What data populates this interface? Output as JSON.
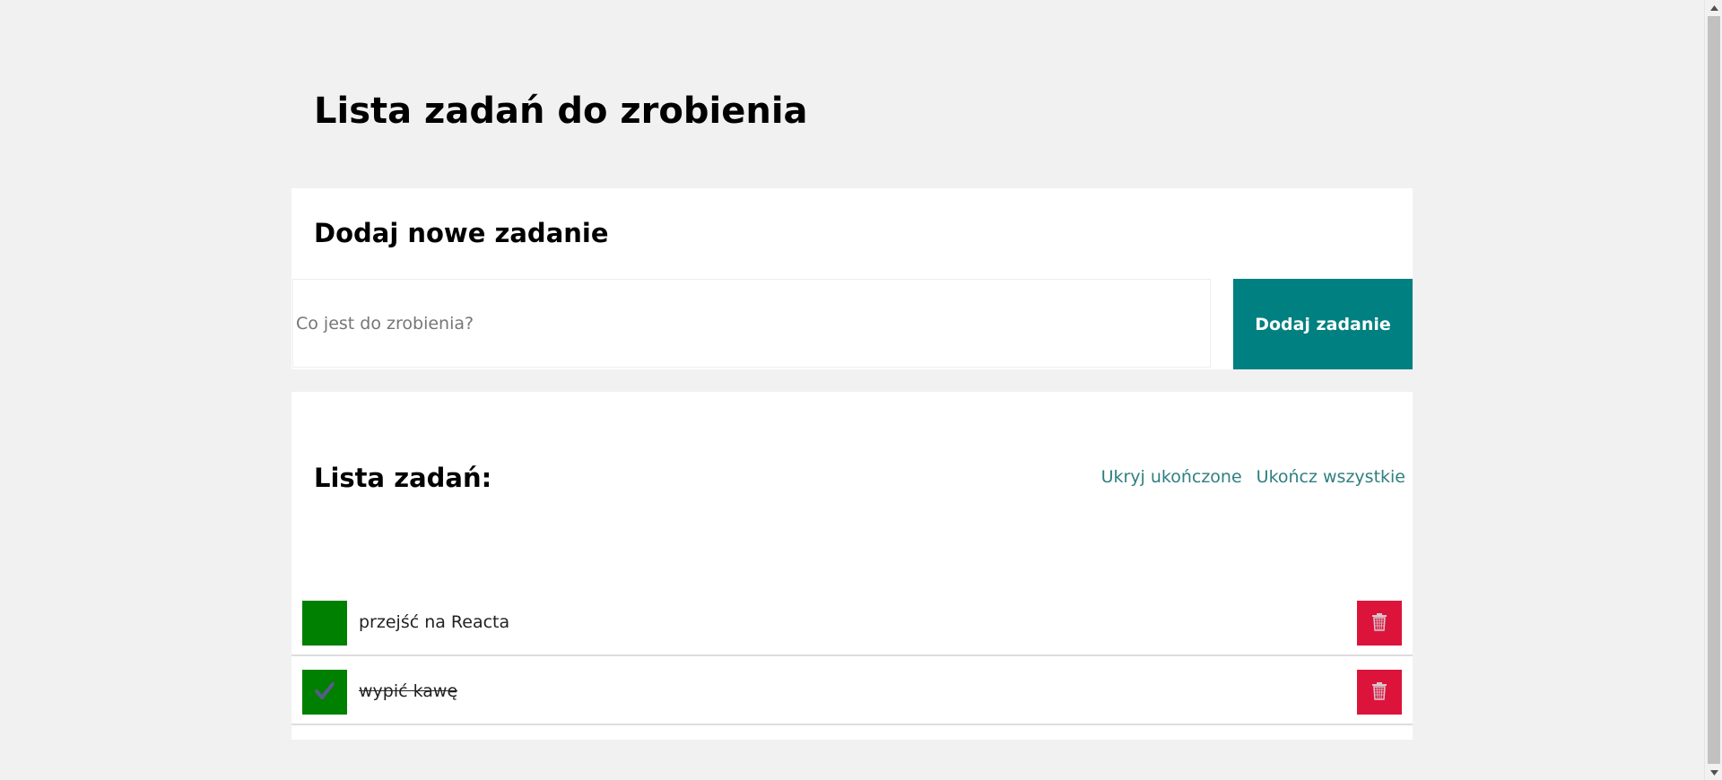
{
  "page": {
    "title": "Lista zadań do zrobienia"
  },
  "add_form": {
    "heading": "Dodaj nowe zadanie",
    "input_value": "",
    "input_placeholder": "Co jest do zrobienia?",
    "submit_label": "Dodaj zadanie"
  },
  "task_list": {
    "heading": "Lista zadań:",
    "hide_done_label": "Ukryj ukończone",
    "finish_all_label": "Ukończ wszystkie",
    "tasks": [
      {
        "content": "przejść na Reacta",
        "done": false
      },
      {
        "content": "wypić kawę",
        "done": true
      }
    ]
  },
  "icons": {
    "done": "check-icon",
    "remove": "trash-icon"
  },
  "colors": {
    "background": "#f1f1f1",
    "panel": "#ffffff",
    "accent": "#008080",
    "done_toggle": "#008000",
    "remove_button": "#dc143c"
  }
}
